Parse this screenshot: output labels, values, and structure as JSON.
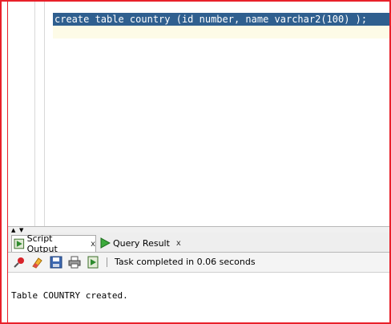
{
  "editor": {
    "code_line": "create table country (id number, name varchar2(100) );"
  },
  "tabs": [
    {
      "label": "Script Output",
      "close": "x",
      "icon": "script-output-icon"
    },
    {
      "label": "Query Result",
      "close": "x",
      "icon": "run-triangle-icon"
    }
  ],
  "toolbar": {
    "icons": [
      "pin-icon",
      "eraser-icon",
      "save-icon",
      "print-icon",
      "script-icon"
    ],
    "status": "Task completed in 0.06 seconds"
  },
  "output": {
    "text": "Table COUNTRY created."
  },
  "colors": {
    "frame": "#e8202a",
    "selection": "#2f5f8f",
    "current_line": "#fdfbe7"
  }
}
